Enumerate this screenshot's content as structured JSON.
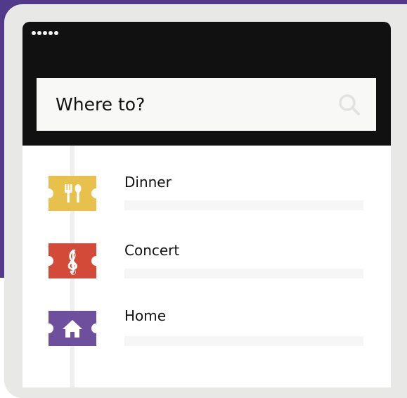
{
  "colors": {
    "purple_bg": "#523a8a",
    "dinner": "#e8c04c",
    "concert": "#d44a38",
    "home": "#6e4f9e"
  },
  "search": {
    "label": "Where to?",
    "icon": "search-icon"
  },
  "destinations": [
    {
      "label": "Dinner",
      "icon": "fork-spoon-icon"
    },
    {
      "label": "Concert",
      "icon": "treble-clef-icon"
    },
    {
      "label": "Home",
      "icon": "house-icon"
    }
  ]
}
